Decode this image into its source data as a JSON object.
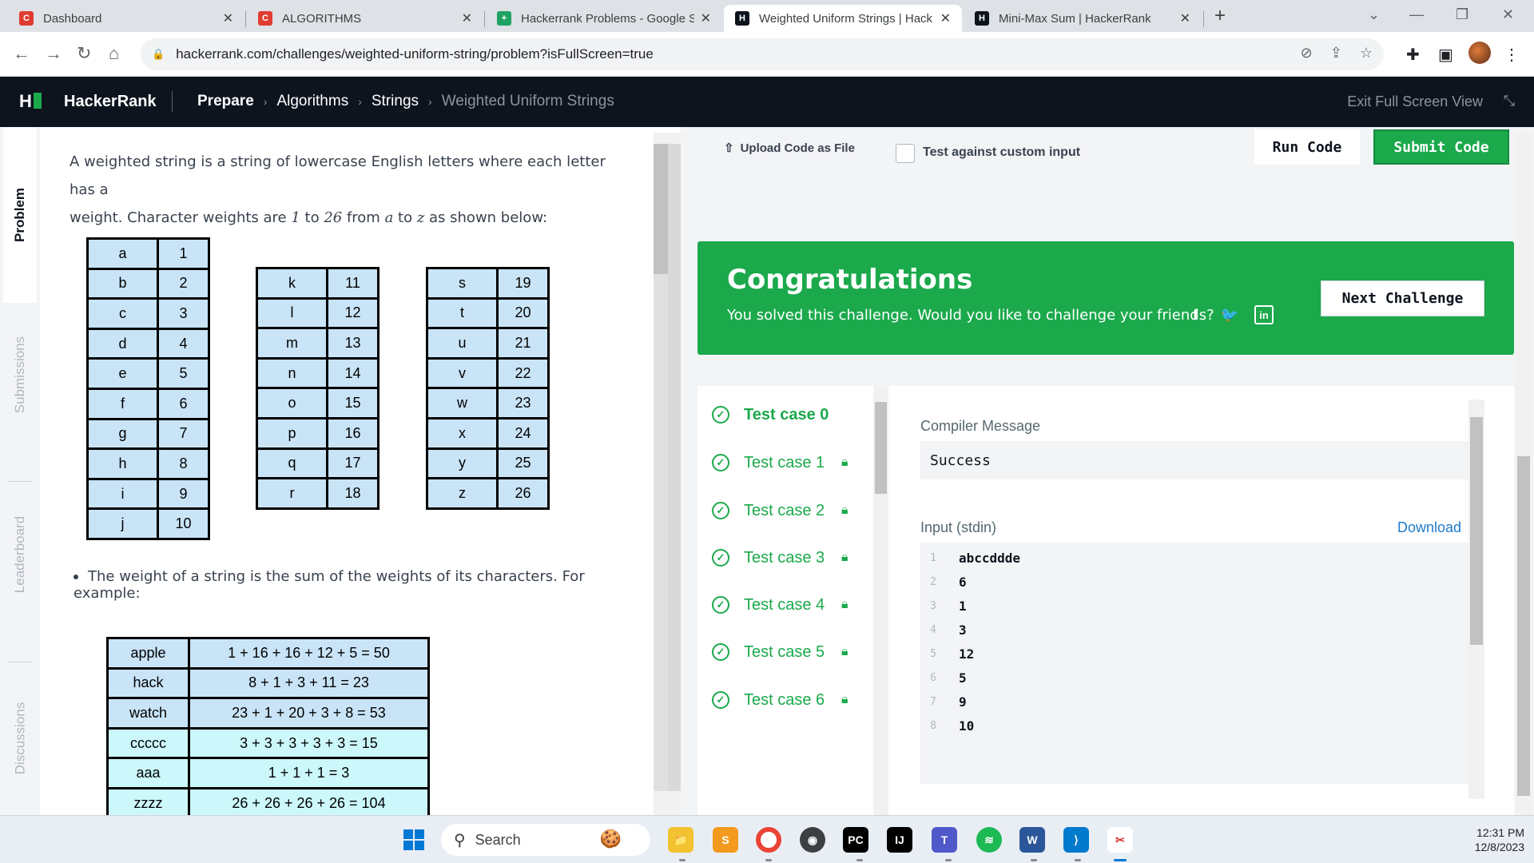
{
  "browser": {
    "tabs": [
      {
        "title": "Dashboard",
        "favicon": "C",
        "favicon_color": "#e03c31"
      },
      {
        "title": "ALGORITHMS",
        "favicon": "C",
        "favicon_color": "#e03c31"
      },
      {
        "title": "Hackerrank Problems - Google S",
        "favicon": "+",
        "favicon_color": "#1ea362"
      },
      {
        "title": "Weighted Uniform Strings | Hack",
        "favicon": "H",
        "favicon_color": "#0e141e"
      },
      {
        "title": "Mini-Max Sum | HackerRank",
        "favicon": "H",
        "favicon_color": "#0e141e"
      }
    ],
    "url": "hackerrank.com/challenges/weighted-uniform-string/problem?isFullScreen=true"
  },
  "header": {
    "brand": "HackerRank",
    "breadcrumbs": [
      "Prepare",
      "Algorithms",
      "Strings",
      "Weighted Uniform Strings"
    ],
    "exit_fullscreen": "Exit Full Screen View"
  },
  "rail": {
    "tabs": [
      "Problem",
      "Submissions",
      "Leaderboard",
      "Discussions"
    ]
  },
  "problem": {
    "intro_1": "A weighted string is a string of lowercase English letters where each letter has a",
    "intro_2a": "weight. Character weights are ",
    "intro_2b": "1",
    "intro_2c": " to ",
    "intro_2d": "26",
    "intro_2e": " from ",
    "intro_2f": "a",
    "intro_2g": " to ",
    "intro_2h": "z",
    "intro_2i": " as shown below:",
    "weights_col1": [
      [
        "a",
        "1"
      ],
      [
        "b",
        "2"
      ],
      [
        "c",
        "3"
      ],
      [
        "d",
        "4"
      ],
      [
        "e",
        "5"
      ],
      [
        "f",
        "6"
      ],
      [
        "g",
        "7"
      ],
      [
        "h",
        "8"
      ],
      [
        "i",
        "9"
      ],
      [
        "j",
        "10"
      ]
    ],
    "weights_col2": [
      [
        "k",
        "11"
      ],
      [
        "l",
        "12"
      ],
      [
        "m",
        "13"
      ],
      [
        "n",
        "14"
      ],
      [
        "o",
        "15"
      ],
      [
        "p",
        "16"
      ],
      [
        "q",
        "17"
      ],
      [
        "r",
        "18"
      ]
    ],
    "weights_col3": [
      [
        "s",
        "19"
      ],
      [
        "t",
        "20"
      ],
      [
        "u",
        "21"
      ],
      [
        "v",
        "22"
      ],
      [
        "w",
        "23"
      ],
      [
        "x",
        "24"
      ],
      [
        "y",
        "25"
      ],
      [
        "z",
        "26"
      ]
    ],
    "bullet": "The weight of a string is the sum of the weights of its characters. For example:",
    "examples": [
      [
        "apple",
        "1 + 16 + 16 + 12 + 5 = 50"
      ],
      [
        "hack",
        "8 + 1 + 3 + 11 = 23"
      ],
      [
        "watch",
        "23 + 1 + 20 + 3 + 8 = 53"
      ],
      [
        "ccccc",
        "3 + 3 + 3 + 3 + 3 = 15"
      ],
      [
        "aaa",
        "1 + 1 + 1 = 3"
      ],
      [
        "zzzz",
        "26 + 26 + 26 + 26 = 104"
      ]
    ]
  },
  "editor": {
    "upload": "Upload Code as File",
    "custom_input": "Test against custom input",
    "run": "Run Code",
    "submit": "Submit Code"
  },
  "congrats": {
    "title": "Congratulations",
    "message": "You solved this challenge. Would you like to challenge your friends?",
    "next": "Next Challenge"
  },
  "testcases": [
    "Test case 0",
    "Test case 1",
    "Test case 2",
    "Test case 3",
    "Test case 4",
    "Test case 5",
    "Test case 6"
  ],
  "result": {
    "compiler_label": "Compiler Message",
    "compiler_message": "Success",
    "input_label": "Input (stdin)",
    "download": "Download",
    "lines": [
      [
        "1",
        "abccddde"
      ],
      [
        "2",
        "6"
      ],
      [
        "3",
        "1"
      ],
      [
        "4",
        "3"
      ],
      [
        "5",
        "12"
      ],
      [
        "6",
        "5"
      ],
      [
        "7",
        "9"
      ],
      [
        "8",
        "10"
      ]
    ]
  },
  "taskbar": {
    "search": "Search",
    "time": "12:31 PM",
    "date": "12/8/2023"
  },
  "colors": {
    "accent_green": "#1ba94c",
    "header_dark": "#0e141e",
    "link_blue": "#1f7bcc"
  }
}
